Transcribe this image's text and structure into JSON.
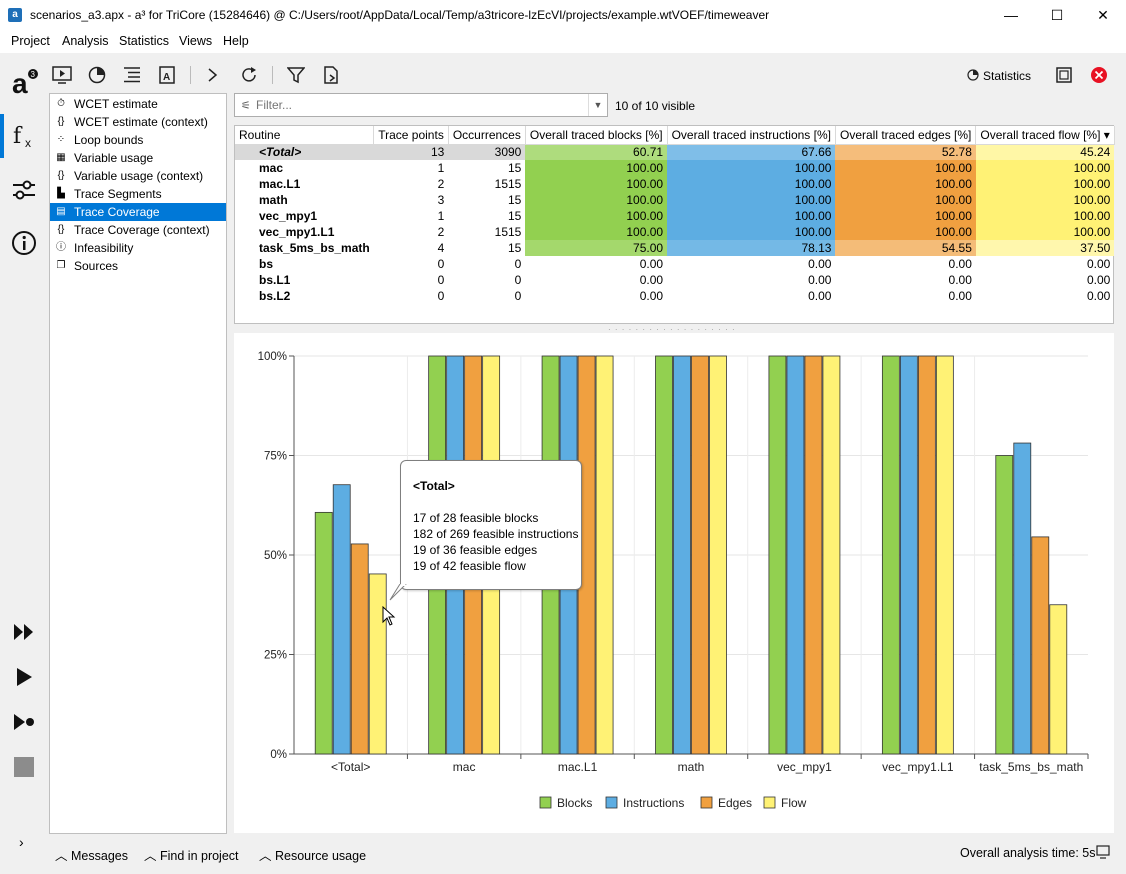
{
  "window": {
    "title": "scenarios_a3.apx - a³ for TriCore (15284646) @ C:/Users/root/AppData/Local/Temp/a3tricore-lzEcVI/projects/example.wtVOEF/timeweaver",
    "minimize": "—",
    "maximize": "☐",
    "close": "✕"
  },
  "menu": [
    "Project",
    "Analysis",
    "Statistics",
    "Views",
    "Help"
  ],
  "toolbar": {
    "statistics_label": "Statistics"
  },
  "nav": {
    "items": [
      {
        "label": "WCET estimate",
        "icon": "stopwatch-icon",
        "glyph": "⏱"
      },
      {
        "label": "WCET estimate (context)",
        "icon": "braces-icon",
        "glyph": "{}"
      },
      {
        "label": "Loop bounds",
        "icon": "loop-icon",
        "glyph": "⁘"
      },
      {
        "label": "Variable usage",
        "icon": "variable-icon",
        "glyph": "▦"
      },
      {
        "label": "Variable usage (context)",
        "icon": "braces-icon",
        "glyph": "{}"
      },
      {
        "label": "Trace Segments",
        "icon": "bar-chart-icon",
        "glyph": "▙"
      },
      {
        "label": "Trace Coverage",
        "icon": "document-icon",
        "glyph": "▤"
      },
      {
        "label": "Trace Coverage (context)",
        "icon": "braces-icon",
        "glyph": "{}"
      },
      {
        "label": "Infeasibility",
        "icon": "info-icon",
        "glyph": "ⓘ"
      },
      {
        "label": "Sources",
        "icon": "files-icon",
        "glyph": "❐"
      }
    ],
    "selected_index": 6
  },
  "filter": {
    "placeholder": "Filter...",
    "visible_text": "10 of 10 visible"
  },
  "table": {
    "columns": [
      "Routine",
      "Trace points",
      "Occurrences",
      "Overall traced blocks [%]",
      "Overall traced instructions [%]",
      "Overall traced edges [%]",
      "Overall traced flow [%]"
    ],
    "sort_indicator": "▾",
    "rows": [
      {
        "routine": "<Total>",
        "trace_points": "13",
        "occurrences": "3090",
        "blocks": "60.71",
        "instructions": "67.66",
        "edges": "52.78",
        "flow": "45.24"
      },
      {
        "routine": "mac",
        "trace_points": "1",
        "occurrences": "15",
        "blocks": "100.00",
        "instructions": "100.00",
        "edges": "100.00",
        "flow": "100.00"
      },
      {
        "routine": "mac.L1",
        "trace_points": "2",
        "occurrences": "1515",
        "blocks": "100.00",
        "instructions": "100.00",
        "edges": "100.00",
        "flow": "100.00"
      },
      {
        "routine": "math",
        "trace_points": "3",
        "occurrences": "15",
        "blocks": "100.00",
        "instructions": "100.00",
        "edges": "100.00",
        "flow": "100.00"
      },
      {
        "routine": "vec_mpy1",
        "trace_points": "1",
        "occurrences": "15",
        "blocks": "100.00",
        "instructions": "100.00",
        "edges": "100.00",
        "flow": "100.00"
      },
      {
        "routine": "vec_mpy1.L1",
        "trace_points": "2",
        "occurrences": "1515",
        "blocks": "100.00",
        "instructions": "100.00",
        "edges": "100.00",
        "flow": "100.00"
      },
      {
        "routine": "task_5ms_bs_math",
        "trace_points": "4",
        "occurrences": "15",
        "blocks": "75.00",
        "instructions": "78.13",
        "edges": "54.55",
        "flow": "37.50"
      },
      {
        "routine": "bs",
        "trace_points": "0",
        "occurrences": "0",
        "blocks": "0.00",
        "instructions": "0.00",
        "edges": "0.00",
        "flow": "0.00"
      },
      {
        "routine": "bs.L1",
        "trace_points": "0",
        "occurrences": "0",
        "blocks": "0.00",
        "instructions": "0.00",
        "edges": "0.00",
        "flow": "0.00"
      },
      {
        "routine": "bs.L2",
        "trace_points": "0",
        "occurrences": "0",
        "blocks": "0.00",
        "instructions": "0.00",
        "edges": "0.00",
        "flow": "0.00"
      }
    ]
  },
  "colors": {
    "blocks": "#92d050",
    "instructions": "#5dade2",
    "edges": "#f0a040",
    "flow": "#fff275",
    "selection": "#0078d7",
    "close_red": "#e81123"
  },
  "chart_data": {
    "type": "bar",
    "categories": [
      "<Total>",
      "mac",
      "mac.L1",
      "math",
      "vec_mpy1",
      "vec_mpy1.L1",
      "task_5ms_bs_math"
    ],
    "series": [
      {
        "name": "Blocks",
        "values": [
          60.71,
          100,
          100,
          100,
          100,
          100,
          75.0
        ]
      },
      {
        "name": "Instructions",
        "values": [
          67.66,
          100,
          100,
          100,
          100,
          100,
          78.13
        ]
      },
      {
        "name": "Edges",
        "values": [
          52.78,
          100,
          100,
          100,
          100,
          100,
          54.55
        ]
      },
      {
        "name": "Flow",
        "values": [
          45.24,
          100,
          100,
          100,
          100,
          100,
          37.5
        ]
      }
    ],
    "yticks": [
      "0%",
      "25%",
      "50%",
      "75%",
      "100%"
    ],
    "ylim": [
      0,
      100
    ],
    "grid": true,
    "legend": "bottom"
  },
  "tooltip": {
    "title": "<Total>",
    "lines": [
      "17 of 28 feasible blocks",
      "182 of 269 feasible instructions",
      "19 of 36 feasible edges",
      "19 of 42 feasible flow"
    ]
  },
  "bottom": {
    "messages": "Messages",
    "find": "Find in project",
    "resource": "Resource usage",
    "analysis_time": "Overall analysis time: 5s"
  }
}
